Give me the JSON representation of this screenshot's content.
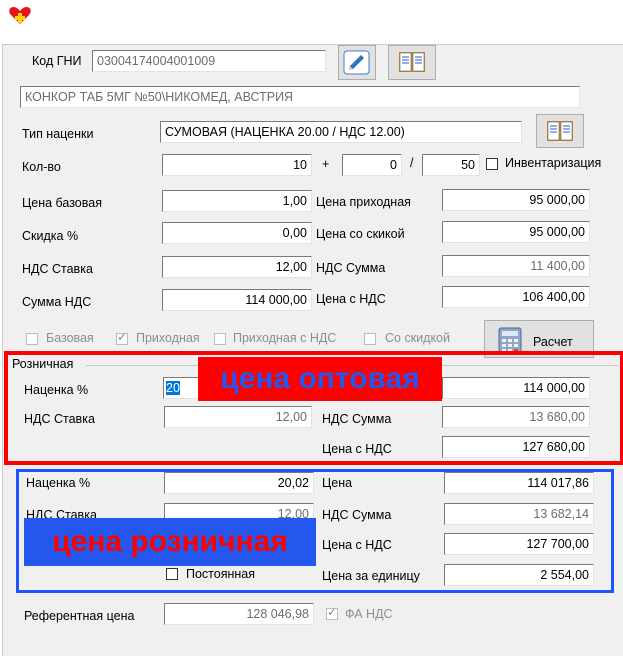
{
  "title_icon": "heart-plus-icon",
  "colors": {
    "red": "#ff0000",
    "blue": "#2357ee",
    "red_text": "#ff0000",
    "blue_text": "#2357ee"
  },
  "kod_gni": {
    "label": "Код ГНИ",
    "value": "03004174004001009"
  },
  "product_name": "КОНКОР ТАБ 5МГ №50\\НИКОМЕД, АВСТРИЯ",
  "markup_type": {
    "label": "Тип наценки",
    "value": "СУМОВАЯ (НАЦЕНКА 20.00 / НДС 12.00)"
  },
  "qty": {
    "label": "Кол-во",
    "value": "10",
    "plus": "+",
    "extra": "0",
    "slash": "/",
    "pack": "50",
    "inventory_label": "Инвентаризация"
  },
  "fields": {
    "base_price": {
      "label": "Цена базовая",
      "value": "1,00"
    },
    "discount": {
      "label": "Скидка %",
      "value": "0,00"
    },
    "vat_rate": {
      "label": "НДС Ставка",
      "value": "12,00"
    },
    "vat_sum_total": {
      "label": "Сумма НДС",
      "value": "114 000,00"
    },
    "price_in": {
      "label": "Цена приходная",
      "value": "95 000,00"
    },
    "price_disc": {
      "label": "Цена со скикой",
      "value": "95 000,00"
    },
    "vat_amount": {
      "label": "НДС Сумма",
      "value": "11 400,00"
    },
    "price_with_vat": {
      "label": "Цена с НДС",
      "value": "106 400,00"
    }
  },
  "basis": {
    "base": "Базовая",
    "incoming": "Приходная",
    "incoming_vat": "Приходная с НДС",
    "with_disc": "Со скидкой"
  },
  "calc_button": "Расчет",
  "retail": {
    "group_label": "Розничная",
    "markup_label": "Наценка %",
    "markup_value": "20",
    "vat_rate_label": "НДС Ставка",
    "vat_rate_value": "12,00",
    "price_value": "114 000,00",
    "vat_sum_label": "НДС Сумма",
    "vat_sum_value": "13 680,00",
    "price_vat_label": "Цена с НДС",
    "price_vat_value": "127 680,00"
  },
  "retail2": {
    "markup_label": "Наценка %",
    "markup_value": "20,02",
    "vat_rate_label": "НДС Ставка",
    "vat_rate_value": "12,00",
    "price_label": "Цена",
    "price_value": "114 017,86",
    "vat_sum_label": "НДС Сумма",
    "vat_sum_value": "13 682,14",
    "price_vat_label": "Цена с НДС",
    "price_vat_value": "127 700,00",
    "unit_label": "Цена за единицу",
    "unit_value": "2 554,00",
    "permanent_label": "Постоянная"
  },
  "reference": {
    "label": "Референтная цена",
    "value": "128 046,98",
    "fa_vat": "ФА НДС"
  },
  "annotations": {
    "wholesale": "цена оптовая",
    "retail": "цена розничная"
  }
}
